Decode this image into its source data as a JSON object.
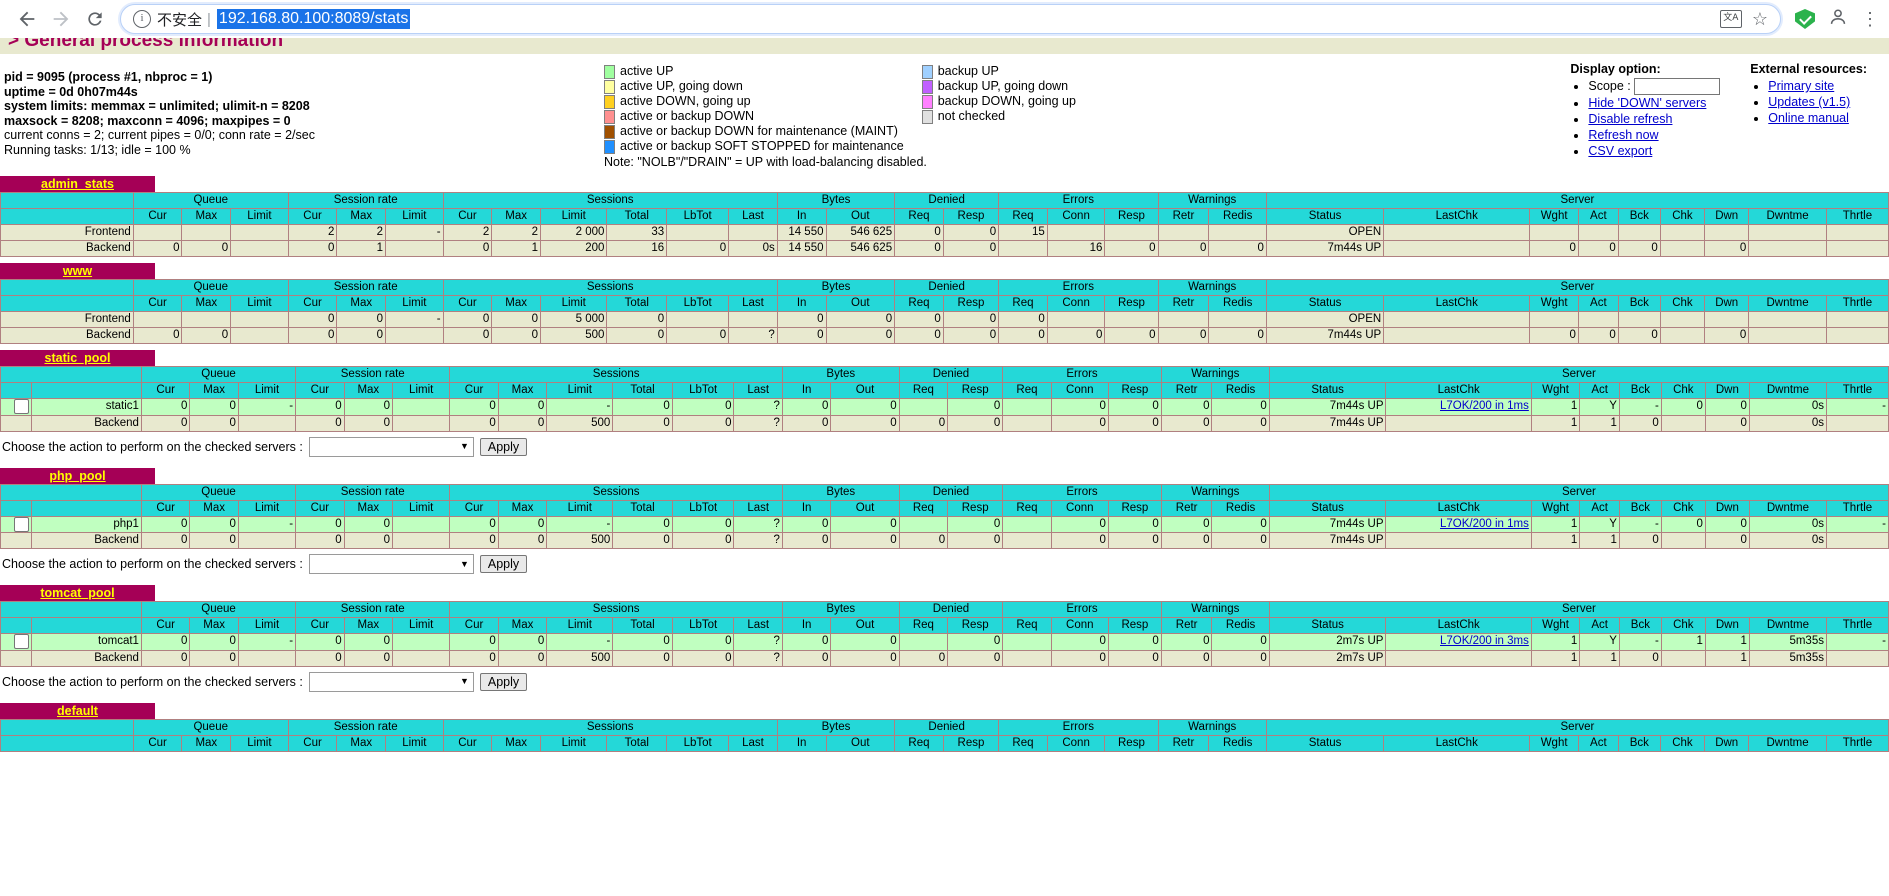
{
  "browser": {
    "back_icon": "back-arrow-icon",
    "forward_icon": "forward-arrow-icon",
    "reload_icon": "reload-icon",
    "security_label": "不安全",
    "url": "192.168.80.100:8089/stats",
    "translate_icon_label": "文A",
    "star_icon": "☆",
    "menu_icon": "⋮"
  },
  "header": {
    "title": "> General process information"
  },
  "process_info": {
    "lines": [
      "pid = 9095 (process #1, nbproc = 1)",
      "uptime = 0d 0h07m44s",
      "system limits: memmax = unlimited; ulimit-n = 8208",
      "maxsock = 8208; maxconn = 4096; maxpipes = 0",
      "current conns = 2; current pipes = 0/0; conn rate = 2/sec",
      "Running tasks: 1/13; idle = 100 %"
    ],
    "pid": "pid = 9095 (process #1, nbproc = 1)",
    "uptime": "uptime = 0d 0h07m44s",
    "system_limits": "system limits: memmax = unlimited; ulimit-n = 8208",
    "maxsock": "maxsock = 8208; maxconn = 4096; maxpipes = 0",
    "current_conns": "current conns = 2; current pipes = 0/0; conn rate = 2/sec",
    "running_tasks": "Running tasks: 1/13; idle = 100 %"
  },
  "legend": {
    "left": [
      {
        "color": "#a0ffa0",
        "label": "active UP"
      },
      {
        "color": "#ffffa0",
        "label": "active UP, going down"
      },
      {
        "color": "#ffd020",
        "label": "active DOWN, going up"
      },
      {
        "color": "#ff9090",
        "label": "active or backup DOWN"
      },
      {
        "color": "#a05000",
        "label": "active or backup DOWN for maintenance (MAINT)"
      },
      {
        "color": "#2090ff",
        "label": "active or backup SOFT STOPPED for maintenance"
      }
    ],
    "right": [
      {
        "color": "#a0d0ff",
        "label": "backup UP"
      },
      {
        "color": "#c060ff",
        "label": "backup UP, going down"
      },
      {
        "color": "#ff80ff",
        "label": "backup DOWN, going up"
      },
      {
        "color": "#e0e0e0",
        "label": "not checked"
      }
    ],
    "note": "Note: \"NOLB\"/\"DRAIN\" = UP with load-balancing disabled."
  },
  "display_option": {
    "title": "Display option:",
    "scope_label": "Scope :",
    "scope_value": "",
    "links": [
      "Hide 'DOWN' servers",
      "Disable refresh",
      "Refresh now",
      "CSV export"
    ]
  },
  "external_resources": {
    "title": "External resources:",
    "links": [
      "Primary site",
      "Updates (v1.5)",
      "Online manual"
    ]
  },
  "table_headers": {
    "groups": [
      "Queue",
      "Session rate",
      "Sessions",
      "Bytes",
      "Denied",
      "Errors",
      "Warnings",
      "Server"
    ],
    "columns": [
      "Cur",
      "Max",
      "Limit",
      "Cur",
      "Max",
      "Limit",
      "Cur",
      "Max",
      "Limit",
      "Total",
      "LbTot",
      "Last",
      "In",
      "Out",
      "Req",
      "Resp",
      "Req",
      "Conn",
      "Resp",
      "Retr",
      "Redis",
      "Status",
      "LastChk",
      "Wght",
      "Act",
      "Bck",
      "Chk",
      "Dwn",
      "Dwntme",
      "Thrtle"
    ]
  },
  "action_bar": {
    "label": "Choose the action to perform on the checked servers :",
    "select_value": "",
    "apply_label": "Apply"
  },
  "proxies": [
    {
      "name": "admin_stats",
      "has_checkbox": false,
      "has_action_bar": false,
      "rows": [
        {
          "type": "frontend",
          "style": "plain",
          "checkbox": false,
          "name": "Frontend",
          "cells": [
            "",
            "",
            "",
            "2",
            "2",
            "-",
            "2",
            "2",
            "2 000",
            "33",
            "",
            "",
            "14 550",
            "546 625",
            "0",
            "0",
            "15",
            "",
            "",
            "",
            "",
            "OPEN",
            "",
            "",
            "",
            "",
            "",
            "",
            "",
            ""
          ]
        },
        {
          "type": "backend",
          "style": "plain",
          "checkbox": false,
          "name": "Backend",
          "cells": [
            "0",
            "0",
            "",
            "0",
            "1",
            "",
            "0",
            "1",
            "200",
            "16",
            "0",
            "0s",
            "14 550",
            "546 625",
            "0",
            "0",
            "",
            "16",
            "0",
            "0",
            "0",
            "7m44s UP",
            "",
            "0",
            "0",
            "0",
            "",
            "0",
            "",
            ""
          ]
        }
      ]
    },
    {
      "name": "www",
      "has_checkbox": false,
      "has_action_bar": false,
      "rows": [
        {
          "type": "frontend",
          "style": "plain",
          "checkbox": false,
          "name": "Frontend",
          "cells": [
            "",
            "",
            "",
            "0",
            "0",
            "-",
            "0",
            "0",
            "5 000",
            "0",
            "",
            "",
            "0",
            "0",
            "0",
            "0",
            "0",
            "",
            "",
            "",
            "",
            "OPEN",
            "",
            "",
            "",
            "",
            "",
            "",
            "",
            ""
          ]
        },
        {
          "type": "backend",
          "style": "plain",
          "checkbox": false,
          "name": "Backend",
          "cells": [
            "0",
            "0",
            "",
            "0",
            "0",
            "",
            "0",
            "0",
            "500",
            "0",
            "0",
            "?",
            "0",
            "0",
            "0",
            "0",
            "0",
            "0",
            "0",
            "0",
            "0",
            "7m44s UP",
            "",
            "0",
            "0",
            "0",
            "",
            "0",
            "",
            ""
          ]
        }
      ]
    },
    {
      "name": "static_pool",
      "has_checkbox": true,
      "has_action_bar": true,
      "rows": [
        {
          "type": "server",
          "style": "active",
          "checkbox": true,
          "name": "static1",
          "cells": [
            "0",
            "0",
            "-",
            "0",
            "0",
            "",
            "0",
            "0",
            "-",
            "0",
            "0",
            "?",
            "0",
            "0",
            "",
            "0",
            "",
            "0",
            "0",
            "0",
            "0",
            "7m44s UP",
            "L7OK/200 in 1ms",
            "1",
            "Y",
            "-",
            "0",
            "0",
            "0s",
            "-"
          ]
        },
        {
          "type": "backend",
          "style": "plain",
          "checkbox": false,
          "name": "Backend",
          "cells": [
            "0",
            "0",
            "",
            "0",
            "0",
            "",
            "0",
            "0",
            "500",
            "0",
            "0",
            "?",
            "0",
            "0",
            "0",
            "0",
            "",
            "0",
            "0",
            "0",
            "0",
            "7m44s UP",
            "",
            "1",
            "1",
            "0",
            "",
            "0",
            "0s",
            ""
          ]
        }
      ]
    },
    {
      "name": "php_pool",
      "has_checkbox": true,
      "has_action_bar": true,
      "rows": [
        {
          "type": "server",
          "style": "active",
          "checkbox": true,
          "name": "php1",
          "cells": [
            "0",
            "0",
            "-",
            "0",
            "0",
            "",
            "0",
            "0",
            "-",
            "0",
            "0",
            "?",
            "0",
            "0",
            "",
            "0",
            "",
            "0",
            "0",
            "0",
            "0",
            "7m44s UP",
            "L7OK/200 in 1ms",
            "1",
            "Y",
            "-",
            "0",
            "0",
            "0s",
            "-"
          ]
        },
        {
          "type": "backend",
          "style": "plain",
          "checkbox": false,
          "name": "Backend",
          "cells": [
            "0",
            "0",
            "",
            "0",
            "0",
            "",
            "0",
            "0",
            "500",
            "0",
            "0",
            "?",
            "0",
            "0",
            "0",
            "0",
            "",
            "0",
            "0",
            "0",
            "0",
            "7m44s UP",
            "",
            "1",
            "1",
            "0",
            "",
            "0",
            "0s",
            ""
          ]
        }
      ]
    },
    {
      "name": "tomcat_pool",
      "has_checkbox": true,
      "has_action_bar": true,
      "rows": [
        {
          "type": "server",
          "style": "active",
          "checkbox": true,
          "name": "tomcat1",
          "cells": [
            "0",
            "0",
            "-",
            "0",
            "0",
            "",
            "0",
            "0",
            "-",
            "0",
            "0",
            "?",
            "0",
            "0",
            "",
            "0",
            "",
            "0",
            "0",
            "0",
            "0",
            "2m7s UP",
            "L7OK/200 in 3ms",
            "1",
            "Y",
            "-",
            "1",
            "1",
            "5m35s",
            "-"
          ]
        },
        {
          "type": "backend",
          "style": "plain",
          "checkbox": false,
          "name": "Backend",
          "cells": [
            "0",
            "0",
            "",
            "0",
            "0",
            "",
            "0",
            "0",
            "500",
            "0",
            "0",
            "?",
            "0",
            "0",
            "0",
            "0",
            "",
            "0",
            "0",
            "0",
            "0",
            "2m7s UP",
            "",
            "1",
            "1",
            "0",
            "",
            "1",
            "5m35s",
            ""
          ]
        }
      ]
    },
    {
      "name": "default",
      "has_checkbox": false,
      "has_action_bar": false,
      "rows": []
    }
  ]
}
